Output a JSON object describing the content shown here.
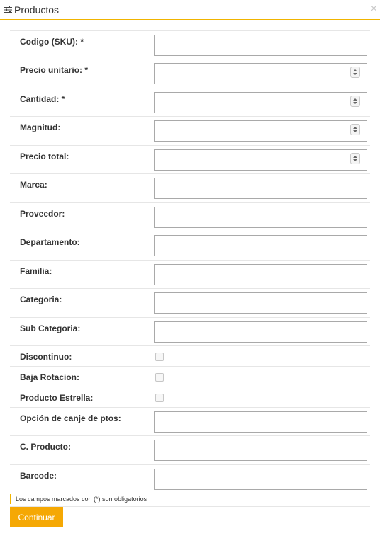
{
  "window": {
    "title": "Productos",
    "close_glyph": "×"
  },
  "fields": [
    {
      "label": "Codigo (SKU): *",
      "type": "text",
      "value": ""
    },
    {
      "label": "Precio unitario: *",
      "type": "number",
      "value": ""
    },
    {
      "label": "Cantidad: *",
      "type": "number",
      "value": ""
    },
    {
      "label": "Magnitud:",
      "type": "number",
      "value": ""
    },
    {
      "label": "Precio total:",
      "type": "number",
      "value": ""
    },
    {
      "label": "Marca:",
      "type": "text",
      "value": ""
    },
    {
      "label": "Proveedor:",
      "type": "text",
      "value": ""
    },
    {
      "label": "Departamento:",
      "type": "text",
      "value": ""
    },
    {
      "label": "Familia:",
      "type": "text",
      "value": ""
    },
    {
      "label": "Categoria:",
      "type": "text",
      "value": ""
    },
    {
      "label": "Sub Categoria:",
      "type": "text",
      "value": ""
    },
    {
      "label": "Discontinuo:",
      "type": "checkbox",
      "checked": false
    },
    {
      "label": "Baja Rotacion:",
      "type": "checkbox",
      "checked": false
    },
    {
      "label": "Producto Estrella:",
      "type": "checkbox",
      "checked": false
    },
    {
      "label": "Opción de canje de ptos:",
      "type": "text",
      "value": ""
    },
    {
      "label": "C. Producto:",
      "type": "text",
      "value": ""
    },
    {
      "label": "Barcode:",
      "type": "text",
      "value": ""
    }
  ],
  "note": "Los campos marcados con (*) son obligatorios",
  "actions": {
    "continue_label": "Continuar"
  },
  "colors": {
    "accent": "#f5a804",
    "title_border": "#f0b400"
  }
}
